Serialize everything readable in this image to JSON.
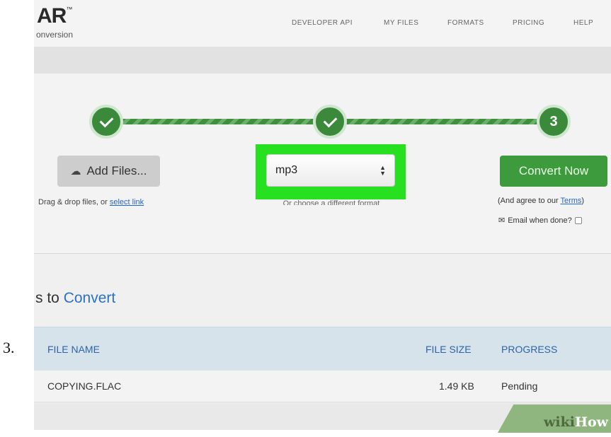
{
  "step": {
    "number": "3."
  },
  "header": {
    "logo": {
      "title": "AR",
      "trademark": "™",
      "subtitle": "onversion"
    },
    "nav": [
      {
        "label": "DEVELOPER API"
      },
      {
        "label": "MY FILES"
      },
      {
        "label": "FORMATS"
      },
      {
        "label": "PRICING"
      },
      {
        "label": "HELP"
      }
    ]
  },
  "converter": {
    "steps": [
      {
        "state": "done",
        "icon": "check-icon"
      },
      {
        "state": "done",
        "icon": "check-icon"
      },
      {
        "state": "current",
        "label": "3"
      }
    ],
    "add_files": {
      "label": "Add Files...",
      "icon": "cloud-upload-icon"
    },
    "drag_text": "Drag & drop files, or ",
    "drag_link": "select link",
    "format": {
      "value": "mp3",
      "icon": "select-arrows-icon"
    },
    "choose_text": "Or choose a different format",
    "convert": {
      "label": "Convert Now"
    },
    "agree_prefix": "(And agree to our ",
    "agree_link": "Terms",
    "agree_suffix": ")",
    "email_label": "Email when done?",
    "email_icon": "envelope-icon",
    "highlight_color": "#27e01f"
  },
  "files": {
    "title_prefix": "s to ",
    "title_accent": "Convert",
    "columns": {
      "name": "FILE NAME",
      "size": "FILE SIZE",
      "progress": "PROGRESS"
    },
    "rows": [
      {
        "name": "COPYING.FLAC",
        "size": "1.49 KB",
        "progress": "Pending"
      }
    ]
  },
  "watermark": {
    "wiki": "wiki",
    "how": "How"
  },
  "colors": {
    "accent": "#2a72c4",
    "brand_green": "#3b8a3b",
    "convert_green": "#3d9a3d"
  }
}
